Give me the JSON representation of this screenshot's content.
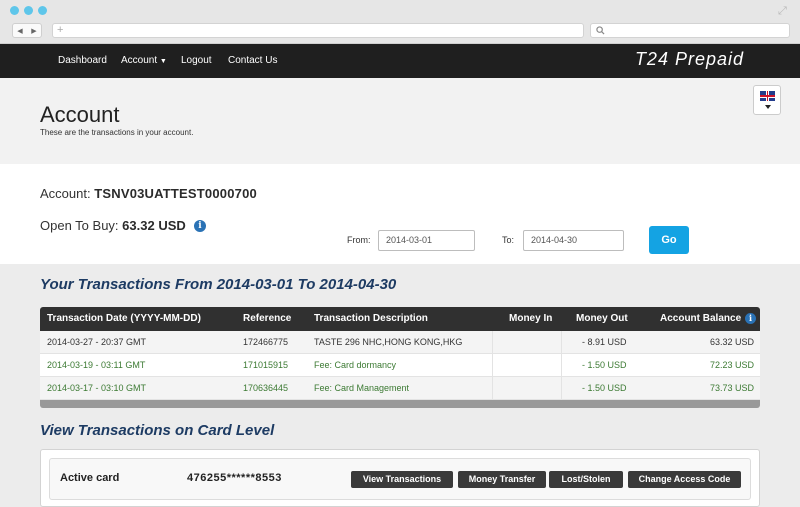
{
  "browser": {
    "address_placeholder": "+",
    "search_icon": "search-icon"
  },
  "nav": {
    "dashboard": "Dashboard",
    "account": "Account",
    "logout": "Logout",
    "contact": "Contact Us",
    "brand": "T24 Prepaid"
  },
  "header": {
    "title": "Account",
    "subtitle": "These are the transactions in your account."
  },
  "account": {
    "label": "Account:",
    "number": "TSNV03UATTEST0000700",
    "otb_label": "Open To Buy:",
    "otb_value": "63.32 USD"
  },
  "filter": {
    "from_label": "From:",
    "from_value": "2014-03-01",
    "to_label": "To:",
    "to_value": "2014-04-30",
    "go_label": "Go"
  },
  "transactions": {
    "title": "Your Transactions From 2014-03-01 To 2014-04-30",
    "headers": [
      "Transaction Date (YYYY-MM-DD)",
      "Reference",
      "Transaction Description",
      "Money In",
      "Money Out",
      "Account Balance"
    ],
    "rows": [
      {
        "date": "2014-03-27 - 20:37 GMT",
        "ref": "172466775",
        "desc": "TASTE 296 NHC,HONG KONG,HKG",
        "in": "",
        "out": "- 8.91 USD",
        "bal": "63.32 USD"
      },
      {
        "date": "2014-03-19 - 03:11 GMT",
        "ref": "171015915",
        "desc": "Fee: Card dormancy",
        "in": "",
        "out": "- 1.50 USD",
        "bal": "72.23 USD"
      },
      {
        "date": "2014-03-17 - 03:10 GMT",
        "ref": "170636445",
        "desc": "Fee: Card Management",
        "in": "",
        "out": "- 1.50 USD",
        "bal": "73.73 USD"
      }
    ]
  },
  "card_level": {
    "title": "View Transactions on Card Level",
    "card_label": "Active card",
    "card_number": "476255******8553",
    "buttons": {
      "view": "View Transactions",
      "transfer": "Money Transfer",
      "lost": "Lost/Stolen",
      "access": "Change Access Code"
    }
  }
}
